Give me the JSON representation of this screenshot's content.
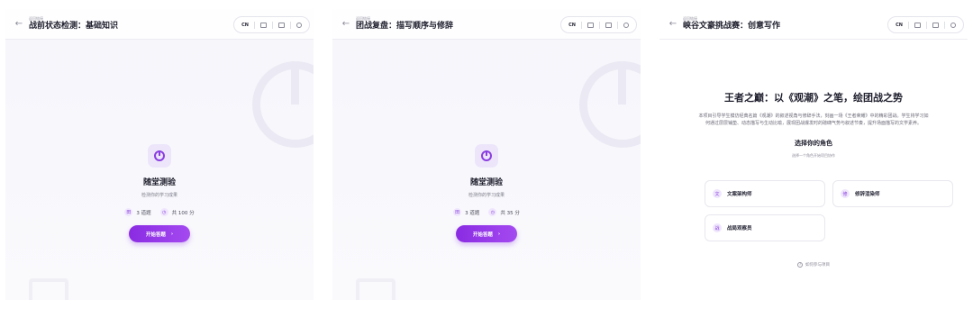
{
  "shared": {
    "breadcrumb": "返回链接",
    "lang": "CN"
  },
  "panel1": {
    "title": "战前状态检测：基础知识",
    "quiz": {
      "title": "随堂测验",
      "subtitle": "检测你的学习成果",
      "questions_icon": "田",
      "questions": "3 道题",
      "points_icon": "◷",
      "points": "共 100 分",
      "button": "开始答题",
      "button_arrow": "›"
    }
  },
  "panel2": {
    "title": "团战复盘：描写顺序与修辞",
    "quiz": {
      "title": "随堂测验",
      "subtitle": "检测你的学习成果",
      "questions_icon": "田",
      "questions": "3 道题",
      "points_icon": "◷",
      "points": "共 35 分",
      "button": "开始答题",
      "button_arrow": "›"
    }
  },
  "panel3": {
    "title": "峡谷文豪挑战赛：创意写作",
    "hero_title": "王者之巅：以《观潮》之笔，绘团战之势",
    "hero_desc": "本项目引导学生模仿经典名篇《观潮》的叙述视角与修辞手法，刻画一场《王者荣耀》中的精彩团战。学生将学习如何通过层层铺垫、动态描写与生动比喻，展现团战爆发时的磅礴气势与叙述节奏，提升场面描写的文学素养。",
    "role_heading": "选择你的角色",
    "role_sub": "选择一个角色开始项目协作",
    "roles": [
      {
        "badge": "文",
        "label": "文案架构师"
      },
      {
        "badge": "修",
        "label": "修辞渲染师"
      },
      {
        "badge": "战",
        "label": "战局观察员"
      }
    ],
    "help_icon": "?",
    "help": "如何参与项目"
  }
}
